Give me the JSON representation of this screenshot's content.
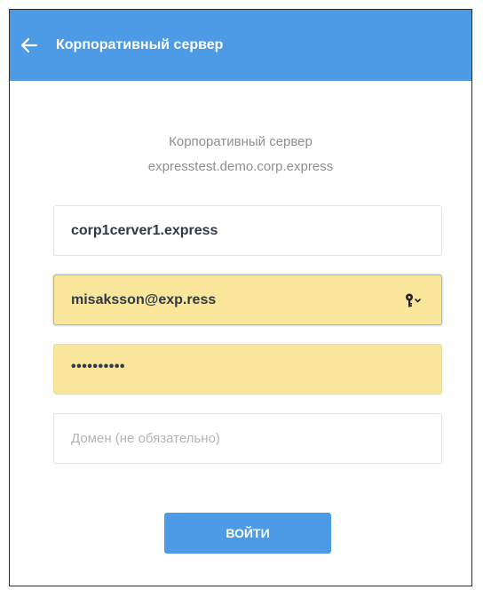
{
  "header": {
    "title": "Корпоративный сервер"
  },
  "server_info": {
    "label": "Корпоративный сервер",
    "host": "expresstest.demo.corp.express"
  },
  "form": {
    "server_field": {
      "value": "corp1cerver1.express"
    },
    "login_field": {
      "value": "misaksson@exp.ress"
    },
    "password_field": {
      "masked_value": "••••••••••"
    },
    "domain_field": {
      "placeholder": "Домен (не обязательно)"
    }
  },
  "login_button": {
    "label": "ВОЙТИ"
  },
  "icons": {
    "back": "arrow-left-icon",
    "credentials": "key-icon"
  },
  "colors": {
    "accent": "#4d9be6",
    "autofill": "#fae69b",
    "muted_text": "#8f8f8f"
  }
}
